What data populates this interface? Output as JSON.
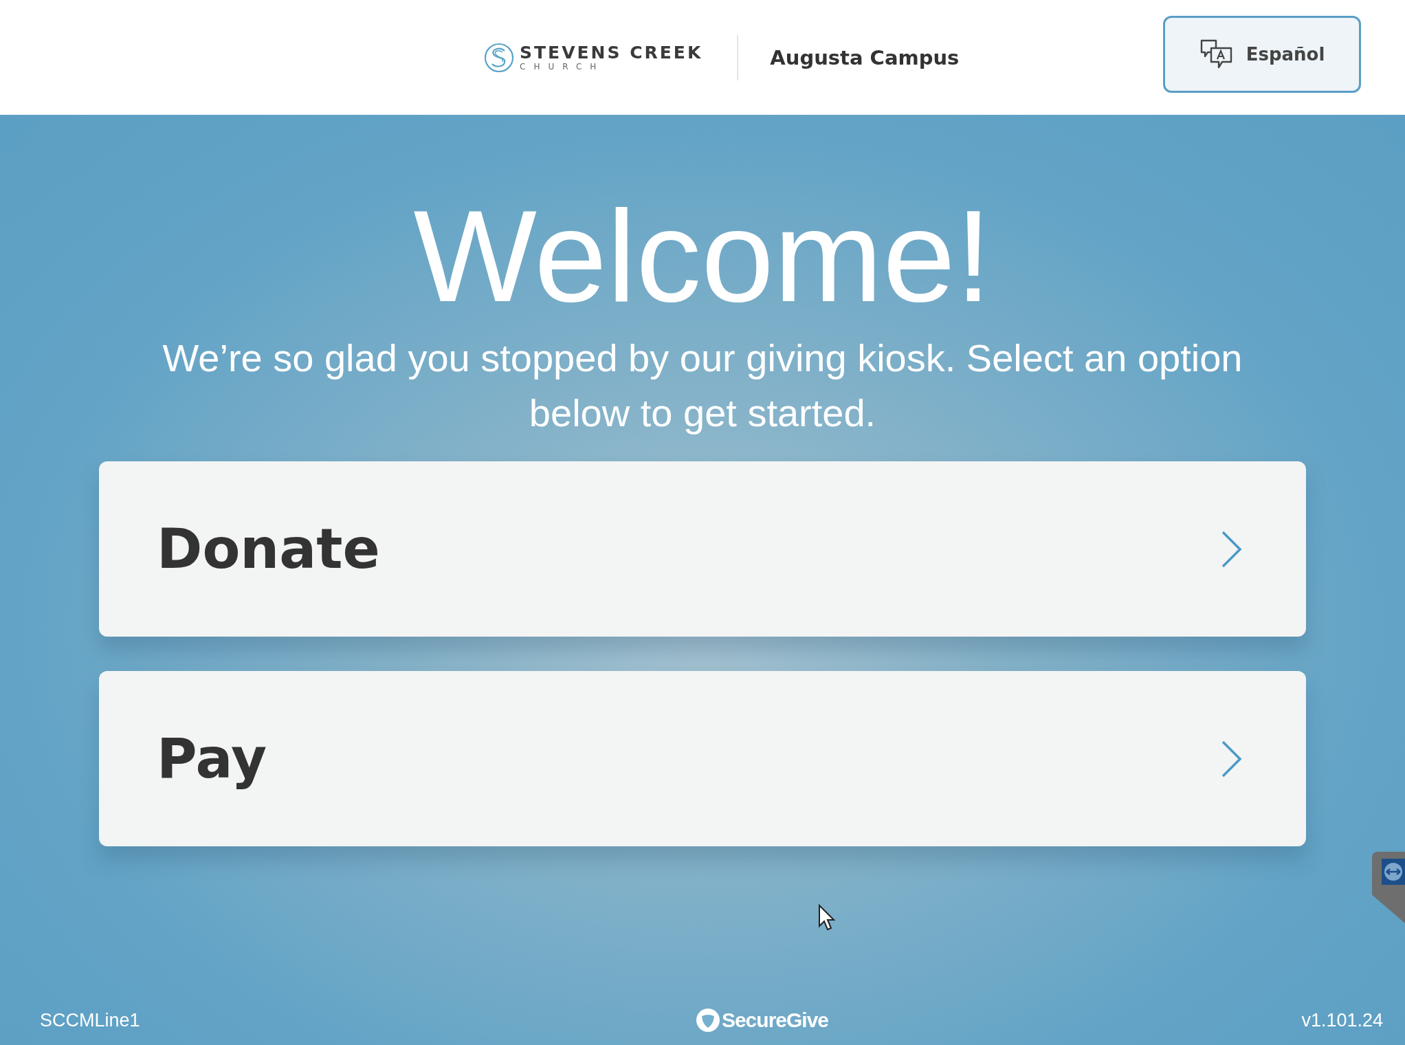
{
  "header": {
    "logo": {
      "name": "STEVENS CREEK",
      "subtitle": "CHURCH"
    },
    "campus": "Augusta Campus",
    "language_button": "Español"
  },
  "welcome": {
    "title": "Welcome!",
    "message": "We’re so glad you stopped by our giving kiosk. Select an option below to get started."
  },
  "options": [
    {
      "label": "Donate"
    },
    {
      "label": "Pay"
    }
  ],
  "footer": {
    "device": "SCCMLine1",
    "brand": "SecureGive",
    "version": "v1.101.24"
  }
}
